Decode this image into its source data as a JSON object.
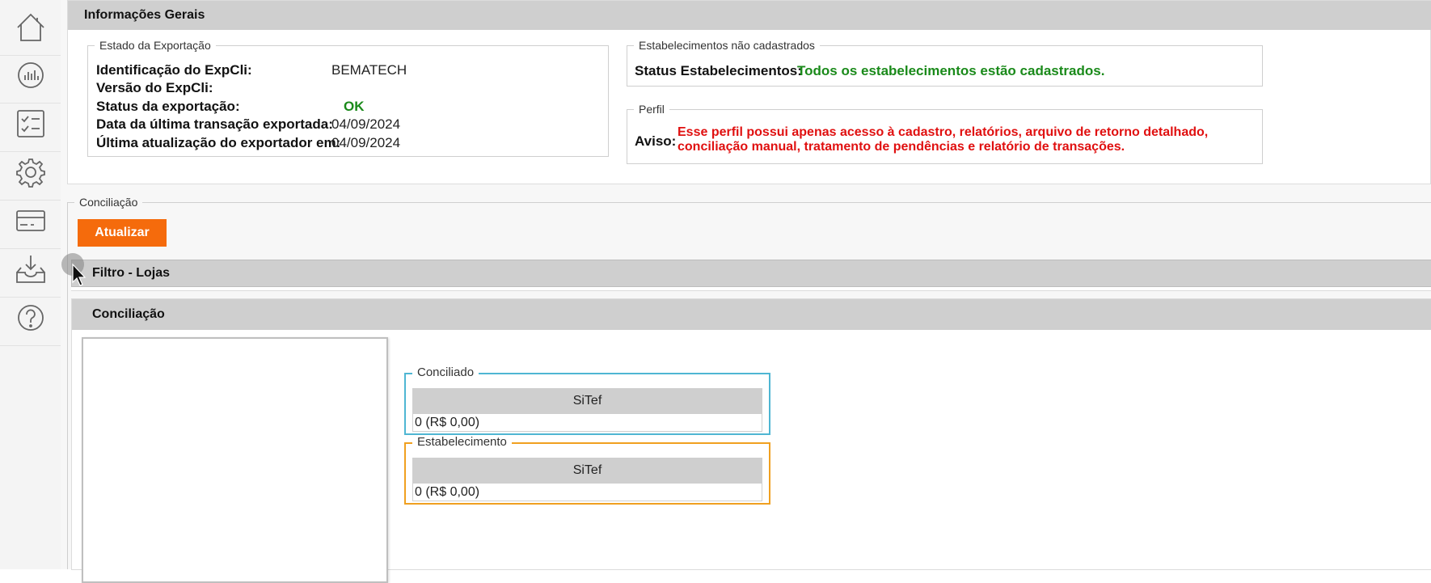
{
  "sidebar": {
    "items": [
      {
        "icon": "home-icon"
      },
      {
        "icon": "dashboard-chart-icon"
      },
      {
        "icon": "checklist-icon"
      },
      {
        "icon": "gear-icon"
      },
      {
        "icon": "card-icon"
      },
      {
        "icon": "inbox-download-icon"
      },
      {
        "icon": "help-icon"
      }
    ]
  },
  "info": {
    "header": "Informações Gerais",
    "export_state": {
      "legend": "Estado da Exportação",
      "rows": [
        {
          "label": "Identificação do ExpCli:",
          "value": "BEMATECH"
        },
        {
          "label": "Versão do ExpCli:",
          "value": ""
        },
        {
          "label": "Status da exportação:",
          "value": "OK"
        },
        {
          "label": "Data da última transação exportada:",
          "value": "04/09/2024"
        },
        {
          "label": "Última atualização do exportador em:",
          "value": "04/09/2024"
        }
      ]
    },
    "establishments": {
      "legend": "Estabelecimentos não cadastrados",
      "label": "Status Estabelecimentos:",
      "value": "Todos os estabelecimentos estão cadastrados."
    },
    "profile": {
      "legend": "Perfil",
      "label": "Aviso:",
      "line1": "Esse perfil possui apenas acesso à cadastro, relatórios, arquivo de retorno detalhado,",
      "line2": "conciliação manual, tratamento de pendências e relatório de transações."
    }
  },
  "conciliacao": {
    "legend": "Conciliação",
    "update_button": "Atualizar",
    "filter_header": "Filtro - Lojas",
    "section_header": "Conciliação",
    "conciliado": {
      "legend": "Conciliado",
      "column": "SiTef",
      "value": "0 (R$ 0,00)"
    },
    "estabelecimento": {
      "legend": "Estabelecimento",
      "column": "SiTef",
      "value": "0 (R$ 0,00)"
    }
  },
  "colors": {
    "accent_orange": "#f56b0c",
    "ok_green": "#1a8a1a",
    "warning_red": "#e01010",
    "conciliado_border": "#4fb6d3",
    "estabelecimento_border": "#f0a020"
  }
}
